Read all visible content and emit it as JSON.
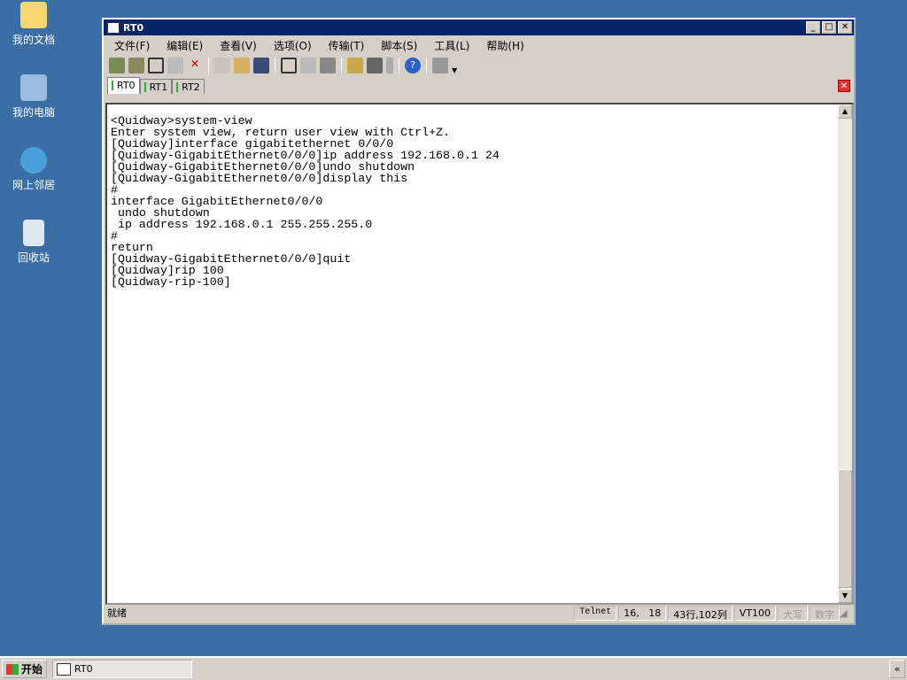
{
  "desktop": {
    "icons": [
      {
        "label": "我的文档",
        "icon": "my-documents-icon"
      },
      {
        "label": "我的电脑",
        "icon": "my-computer-icon"
      },
      {
        "label": "网上邻居",
        "icon": "network-icon"
      },
      {
        "label": "回收站",
        "icon": "recycle-bin-icon"
      }
    ]
  },
  "window": {
    "title": "RT0",
    "menu": [
      "文件(F)",
      "编辑(E)",
      "查看(V)",
      "选项(O)",
      "传输(T)",
      "脚本(S)",
      "工具(L)",
      "帮助(H)"
    ],
    "tabs": [
      {
        "label": "RT0",
        "active": true
      },
      {
        "label": "RT1"
      },
      {
        "label": "RT2"
      }
    ],
    "terminal": "<Quidway>system-view\nEnter system view, return user view with Ctrl+Z.\n[Quidway]interface gigabitethernet 0/0/0\n[Quidway-GigabitEthernet0/0/0]ip address 192.168.0.1 24\n[Quidway-GigabitEthernet0/0/0]undo shutdown\n[Quidway-GigabitEthernet0/0/0]display this\n#\ninterface GigabitEthernet0/0/0\n undo shutdown\n ip address 192.168.0.1 255.255.255.0\n#\nreturn\n[Quidway-GigabitEthernet0/0/0]quit\n[Quidway]rip 100\n[Quidway-rip-100]",
    "status": {
      "ready": "就绪",
      "protocol": "Telnet",
      "cursor": "16,   18",
      "size": "43行,102列",
      "emulation": "VT100",
      "caps": "大写",
      "num": "数字"
    }
  },
  "taskbar": {
    "start": "开始",
    "task": "RT0",
    "tray": "«"
  },
  "colors": {
    "desktop": "#3a6ea5",
    "titlebar": "#0a246a",
    "tab_indicator": "#2bb02b"
  }
}
